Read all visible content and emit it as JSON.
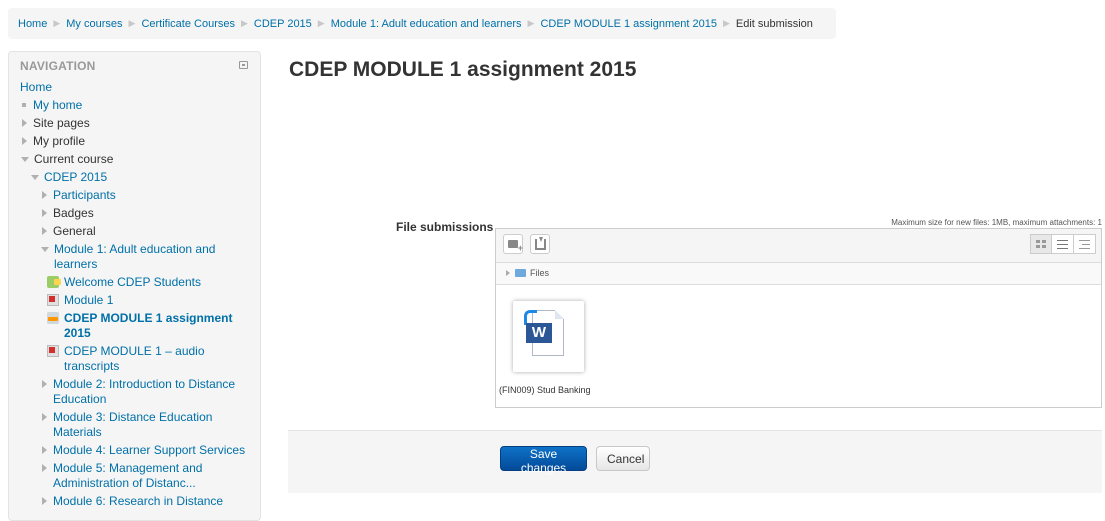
{
  "breadcrumb": {
    "items": [
      "Home",
      "My courses",
      "Certificate Courses",
      "CDEP 2015",
      "Module 1: Adult education and learners",
      "CDEP MODULE 1 assignment 2015"
    ],
    "current": "Edit submission"
  },
  "navigation": {
    "title": "NAVIGATION",
    "items": [
      "Home",
      "My home",
      "Site pages",
      "My profile",
      "Current course",
      "CDEP 2015",
      "Participants",
      "Badges",
      "General",
      "Module 1: Adult education and learners",
      "Welcome CDEP Students",
      "Module 1",
      "CDEP MODULE 1 assignment 2015",
      "CDEP MODULE 1 – audio transcripts",
      "Module 2: Introduction to Distance Education",
      "Module 3: Distance Education Materials",
      "Module 4: Learner Support Services",
      "Module 5: Management and Administration of Distanc...",
      "Module 6: Research in Distance"
    ]
  },
  "main": {
    "title": "CDEP MODULE 1 assignment 2015",
    "field_label": "File submissions",
    "max_size": "Maximum size for new files: 1MB, maximum attachments: 1",
    "path_label": "Files",
    "file_name": "(FIN009) Stud Banking",
    "file_name_2": "...",
    "save_label": "Save changes",
    "cancel_label": "Cancel"
  },
  "colors": {
    "link": "#0070a8",
    "primary_button": "#0a5ba8",
    "panel_bg": "#f5f5f5"
  },
  "icons": {
    "add_file": "folder-plus-icon",
    "download": "download-icon",
    "view_icons": "grid-icon",
    "view_details": "list-icon",
    "view_tree": "tree-icon",
    "file": "word-document-icon"
  }
}
